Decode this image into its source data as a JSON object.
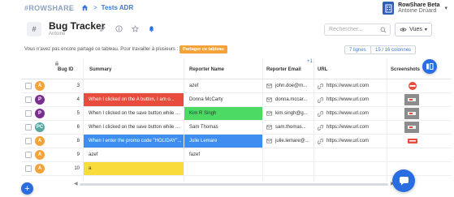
{
  "topbar": {
    "logo": "ROWSHARE",
    "breadcrumb": "Tests ADR",
    "user_app": "RowShare Beta",
    "user_name": "Antoine Drúard"
  },
  "header": {
    "title": "Bug Tracker",
    "subtitle": "Antoine",
    "search_placeholder": "Rechercher...",
    "views_label": "Vues"
  },
  "strip": {
    "message": "Vous n'avez pas encore partagé ce tableau. Pour travailler à plusieurs :",
    "share_label": "Partager ce tableau",
    "lines_label": "7 lignes",
    "columns_label": "15 / 16 colonnes"
  },
  "columns": [
    "Bug ID",
    "Summary",
    "Reporter Name",
    "Reporter Email",
    "URL",
    "Screenshots"
  ],
  "colors": {
    "accent": "#2a6de0",
    "red": "#e74c3c",
    "green": "#4cd964",
    "blue": "#3d8ef0",
    "yellow": "#f7dc3b",
    "share": "#f5a23b"
  },
  "rows": [
    {
      "avatar": "A",
      "avatar_color": "#f5a23b",
      "id": "3",
      "summary": "",
      "summary_bg": "",
      "name": "azef",
      "name_bg": "",
      "email": "john.doe@m...",
      "url": "https://www.url.com",
      "thumb": "red"
    },
    {
      "avatar": "P",
      "avatar_color": "#7a2e8f",
      "id": "4",
      "summary": "When I clicked on the A button, I am o...",
      "summary_bg": "#e74c3c",
      "name": "Donna McCarty",
      "name_bg": "",
      "email": "donna.mccar...",
      "url": "https://www.url.com",
      "thumb": "grey"
    },
    {
      "avatar": "P",
      "avatar_color": "#7a2e8f",
      "id": "5",
      "summary": "When I clicked on the save button while ...",
      "summary_bg": "",
      "name": "Kim R Singh",
      "name_bg": "#4cd964",
      "email": "kim.singh@g...",
      "url": "https://www.url.com",
      "thumb": "grey"
    },
    {
      "avatar": "PC",
      "avatar_color": "#5aa9a0",
      "id": "6",
      "summary": "When I clicked on the save button while ...",
      "summary_bg": "",
      "name": "Sam Thomas",
      "name_bg": "",
      "email": "sam.thomas...",
      "url": "https://www.url.com",
      "thumb": "grey"
    },
    {
      "avatar": "A",
      "avatar_color": "#f5a23b",
      "id": "8",
      "summary": "When I enter the promo code \"HOLIDAY\"...",
      "summary_bg": "#3d8ef0",
      "name": "Julie Lemare",
      "name_bg": "#3d8ef0",
      "email": "julie.lemare@...",
      "url": "https://www.url.com",
      "thumb": "red-small"
    },
    {
      "avatar": "A",
      "avatar_color": "#f5a23b",
      "id": "9",
      "summary": "azef",
      "summary_bg": "",
      "name": "fazef",
      "name_bg": "",
      "email": "",
      "url": "",
      "thumb": "none"
    },
    {
      "avatar": "A",
      "avatar_color": "#f5a23b",
      "id": "10",
      "summary": "a",
      "summary_bg": "#f7dc3b",
      "name": "",
      "name_bg": "",
      "email": "",
      "url": "",
      "thumb": "none"
    }
  ]
}
